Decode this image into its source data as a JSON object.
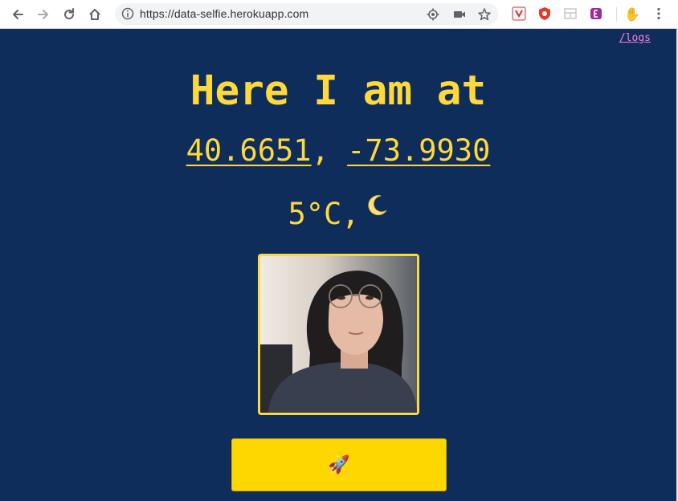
{
  "browser": {
    "url": "https://data-selfie.herokuapp.com",
    "icons": [
      "back-icon",
      "forward-icon",
      "reload-icon",
      "home-icon",
      "info-icon",
      "location-icon",
      "camera-icon",
      "bookmark-star-icon",
      "extension-icons",
      "more-menu-icon"
    ]
  },
  "page": {
    "logs_link": "/logs",
    "headline": "Here I am at",
    "latitude": "40.6651",
    "coord_separator": ", ",
    "longitude": "-73.9930",
    "temperature": "5°C,",
    "weather_icon": "crescent-moon-icon",
    "button_icon": "rocket-icon"
  },
  "colors": {
    "page_background": "#0f2d5a",
    "text_accent": "#ffd93b",
    "button_background": "#ffd700",
    "link": "#ff7ce6"
  }
}
